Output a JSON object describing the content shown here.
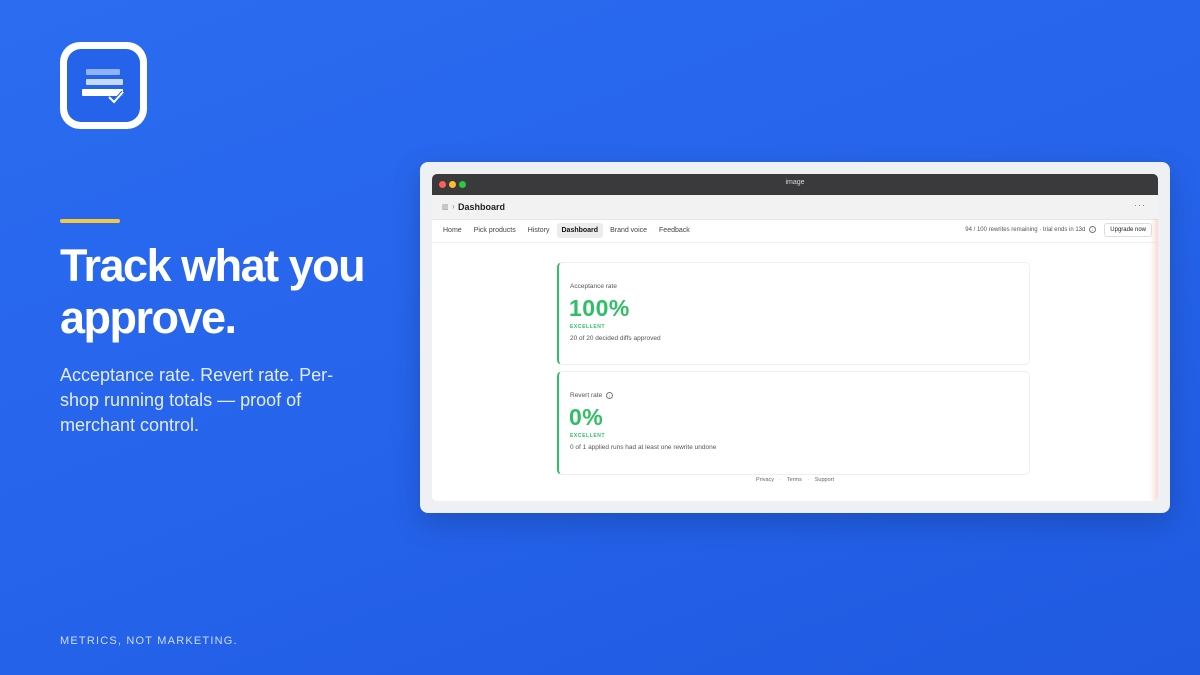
{
  "slide": {
    "headline": "Track what you approve.",
    "subtext": "Acceptance rate. Revert rate. Per-shop running totals — proof of merchant control.",
    "footer_tag": "METRICS, NOT MARKETING.",
    "accent_color": "#f5c842",
    "background_color": "#2563eb",
    "logo_icon": "stacked-document-check-icon"
  },
  "window": {
    "title": "image",
    "breadcrumb_icon": "app-icon",
    "page_title": "Dashboard",
    "more_label": "···"
  },
  "nav": {
    "tabs": [
      "Home",
      "Pick products",
      "History",
      "Dashboard",
      "Brand voice",
      "Feedback"
    ],
    "active_tab": "Dashboard",
    "usage_text": "94 / 100 rewrites remaining · trial ends in 13d",
    "upgrade_label": "Upgrade now"
  },
  "metrics": {
    "acceptance": {
      "label": "Acceptance rate",
      "value": "100%",
      "badge": "EXCELLENT",
      "description": "20 of 20 decided diffs approved"
    },
    "revert": {
      "label": "Revert rate",
      "value": "0%",
      "badge": "EXCELLENT",
      "description": "0 of 1 applied runs had at least one rewrite undone"
    },
    "success_color": "#2fbf64"
  },
  "footer": {
    "links": [
      "Privacy",
      "Terms",
      "Support"
    ],
    "separator": "·"
  }
}
